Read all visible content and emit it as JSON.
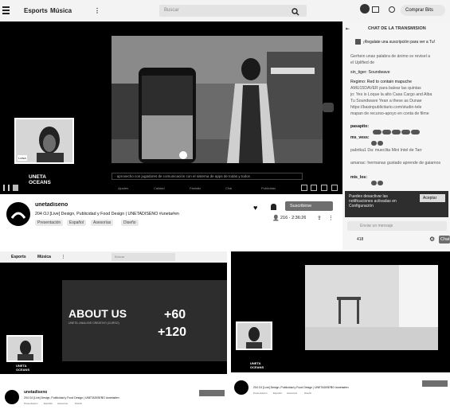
{
  "nav": {
    "explore": "Esports",
    "music": "Música",
    "more": "⋮",
    "search_placeholder": "Buscar",
    "subscribe_button": "Comprar Bits"
  },
  "main_stream": {
    "brand_logo": "UNETA\nOCEANS",
    "caption_bar": "· aprovecho con jugadores de comunicación con el sistema de apps de todas y todos",
    "controls": [
      "Ajustes",
      "Calidad",
      "Pantalla",
      "Chat",
      "Publicidad"
    ],
    "cam_label": "Luisa",
    "cam_label2": "Jefa de Aplicación"
  },
  "channel": {
    "name": "unetadiseno",
    "title": "204 OJ [Live] Design, Publicidad y Food Design  | UNETADISEÑO #uneta#en",
    "tags": [
      "Presentación",
      "Español",
      "Asesorías",
      "Diseño"
    ],
    "viewer_stat": "216 · 2:36:26",
    "follow_button": "Seguir",
    "subscribe_button": "Suscribirse"
  },
  "chat": {
    "header": "CHAT DE LA TRANSMISIÓN",
    "pinned": "¡Regalate una suscripción para ver a Tu!",
    "lines": [
      "Gerhein unas palabra de ánimo sv revisel a",
      "el Uplified de",
      "sin_tiger: Soundwave",
      "Regimo: Red to contain mapuche",
      "AMU15DAVER para balear las quintas",
      "jo: Yes is Loque la alto Casa Cargo and Alba",
      "Tu Soundwave Yean a these as Dunae",
      "https://basinpublicitario.com/studio-tele",
      "mapan de recurso-apoyo en conta de filme",
      "pasapito:",
      "ms_vess:",
      "pabrika1 Da: mueclita Mini Intel de Tarr",
      "amanac: hermanas gustado aprende de gaiamos",
      "mis_los:"
    ],
    "notice": "Puedes desactivar las notificaciones activadas en Configuración",
    "notice_button": "Aceptar",
    "input_placeholder": "Enviar un mensaje",
    "points": "418",
    "chat_button": "Chat"
  },
  "bottom_left": {
    "nav_items": [
      "Esports",
      "Música",
      "⋮"
    ],
    "search_placeholder": "Buscar",
    "slide_title": "ABOUT US",
    "slide_sub": "UNETA: ANALISIS CREATIVO (CURSO)",
    "stat_1": "+60",
    "stat_2": "+120",
    "brand_logo": "UNETA\nOCEANS",
    "channel_name": "unetadiseno",
    "channel_title": "204 OJ [Live] Design, Publicidad y Food Design | UNETADISEÑO #uneta#en",
    "tags": [
      "Presentación",
      "Español",
      "Asesorías",
      "Diseño"
    ]
  },
  "bottom_right": {
    "brand_logo": "UNETA\nOCEANS",
    "channel_title": "204 OJ [Live] Design, Publicidad y Food Design | UNETADISEÑO #uneta#en",
    "tags": [
      "Presentación",
      "Español",
      "Asesorías",
      "Diseño"
    ]
  },
  "colors": {
    "black": "#000000",
    "panel": "#2d2d2d",
    "chip": "#6e6e6e"
  }
}
